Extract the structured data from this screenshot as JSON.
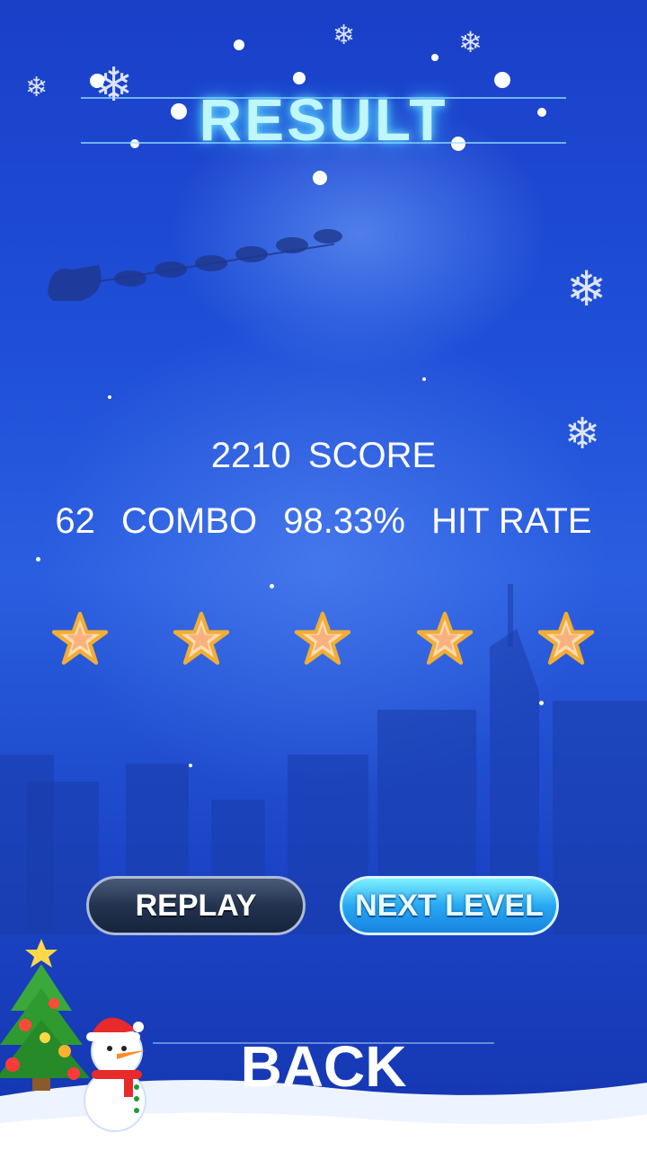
{
  "title": "RESULT",
  "score": {
    "value": "2210",
    "label": "SCORE"
  },
  "stats": {
    "combo_value": "62",
    "combo_label": "COMBO",
    "hit_rate_value": "98.33%",
    "hit_rate_label": "HIT RATE"
  },
  "stars": {
    "earned": 5,
    "total": 5
  },
  "buttons": {
    "replay": "REPLAY",
    "next_level": "NEXT LEVEL",
    "back": "BACK"
  },
  "colors": {
    "background": "#1f4fd8",
    "title_glow": "#6fe3ff",
    "star_fill": "#ffd9a8",
    "star_outline": "#f3b23b"
  }
}
